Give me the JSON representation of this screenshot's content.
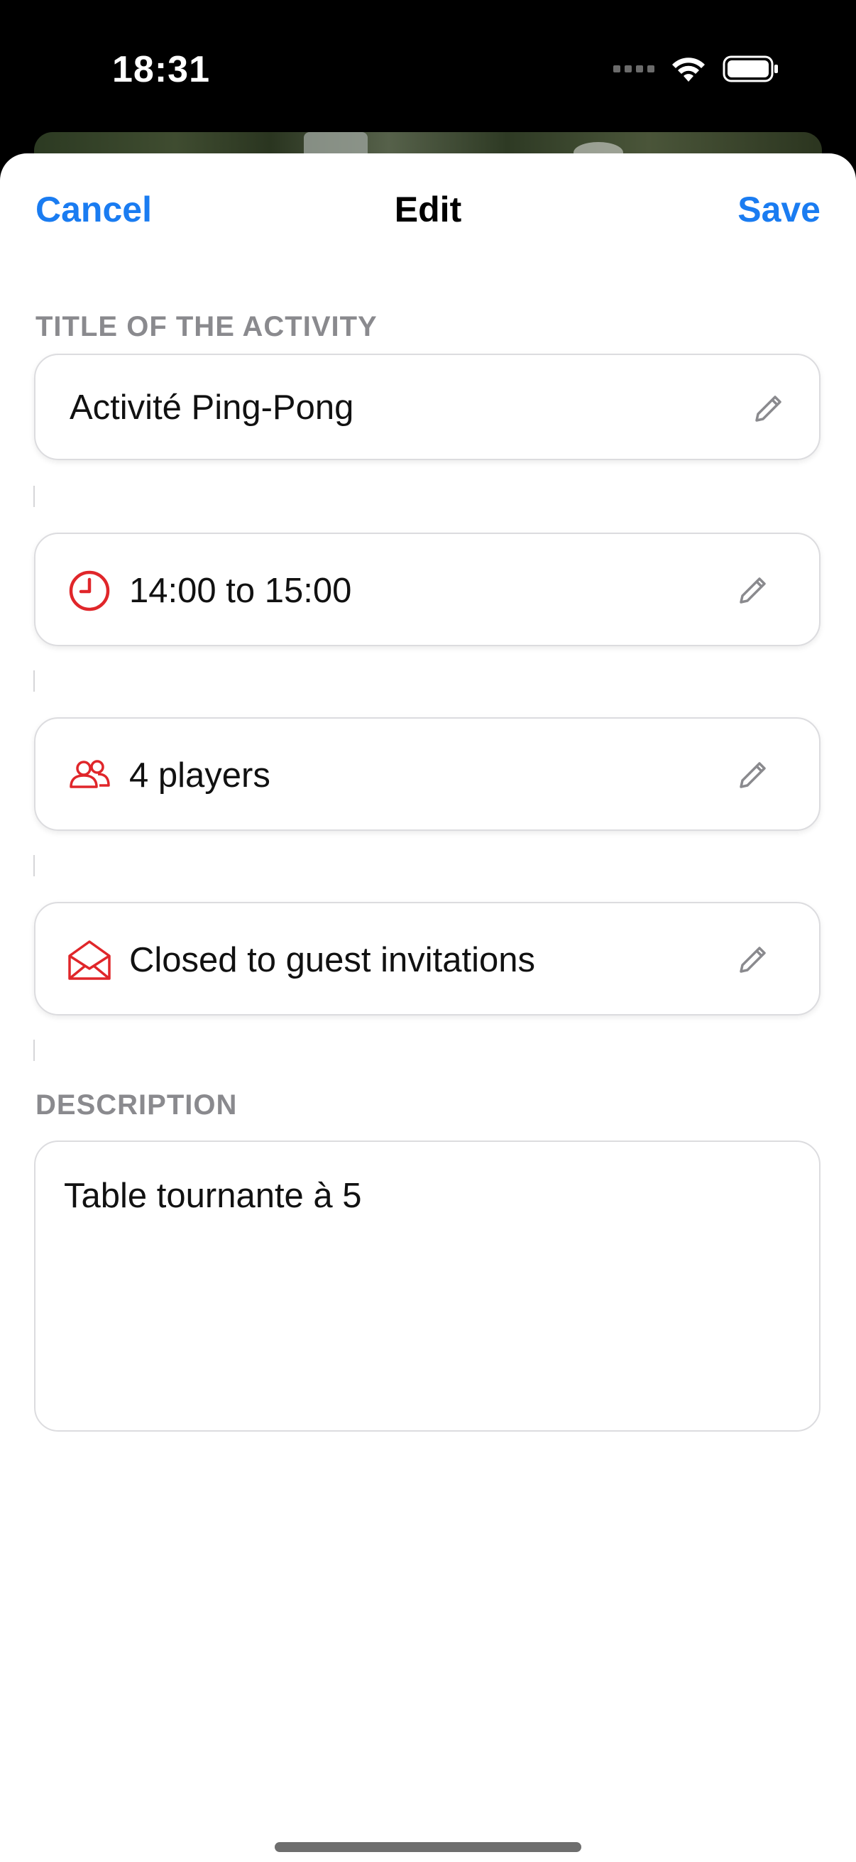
{
  "status_bar": {
    "time": "18:31",
    "icons": [
      "cellular-dots-icon",
      "wifi-icon",
      "battery-icon"
    ]
  },
  "nav": {
    "cancel_label": "Cancel",
    "title": "Edit",
    "save_label": "Save"
  },
  "colors": {
    "accent": "#1a7cf1",
    "icon_red": "#e0262a",
    "label_gray": "#8a8a8e"
  },
  "title_section": {
    "label": "TITLE OF THE ACTIVITY",
    "value": "Activité Ping-Pong"
  },
  "fields": [
    {
      "icon": "clock-icon",
      "text": "14:00 to 15:00"
    },
    {
      "icon": "people-icon",
      "text": "4 players"
    },
    {
      "icon": "envelope-open-icon",
      "text": "Closed to guest invitations"
    }
  ],
  "description_section": {
    "label": "DESCRIPTION",
    "value": "Table tournante à 5"
  }
}
